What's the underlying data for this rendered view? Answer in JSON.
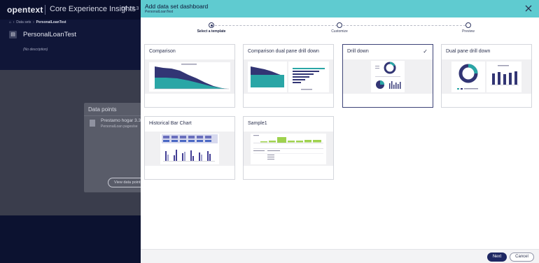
{
  "background": {
    "brand": "opentext",
    "product": "Core Experience Insights",
    "version": "CE 22.3",
    "breadcrumbs": [
      "Data sets",
      "PersonalLoanTest"
    ],
    "page_title": "PersonalLoanTest",
    "description": "(No description)",
    "panel": {
      "title": "Data points",
      "item_name": "Prestamo hogar 3.3",
      "item_sub": "PersonalLoan pages/se",
      "view_button": "View data points"
    }
  },
  "modal": {
    "title": "Add data set dashboard",
    "subtitle": "PersonalLoanTest",
    "steps": [
      {
        "label": "Select a template",
        "active": true
      },
      {
        "label": "Customize",
        "active": false
      },
      {
        "label": "Preview",
        "active": false
      }
    ],
    "templates": [
      {
        "name": "Comparison",
        "selected": false
      },
      {
        "name": "Comparison dual pane drill down",
        "selected": false
      },
      {
        "name": "Drill down",
        "selected": true
      },
      {
        "name": "Dual pane drill down",
        "selected": false
      },
      {
        "name": "Historical Bar Chart",
        "selected": false
      },
      {
        "name": "Sample1",
        "selected": false
      }
    ],
    "buttons": {
      "next": "Next",
      "cancel": "Cancel"
    },
    "icons": {
      "close": "close-icon",
      "selected": "checkmark-icon"
    }
  },
  "colors": {
    "header_teal": "#5fcbd0",
    "primary_navy": "#1e2762",
    "chart_navy": "#2e2f6e",
    "chart_teal": "#2aa6a6",
    "chart_green": "#9fd24e",
    "chart_purple": "#433f95"
  }
}
